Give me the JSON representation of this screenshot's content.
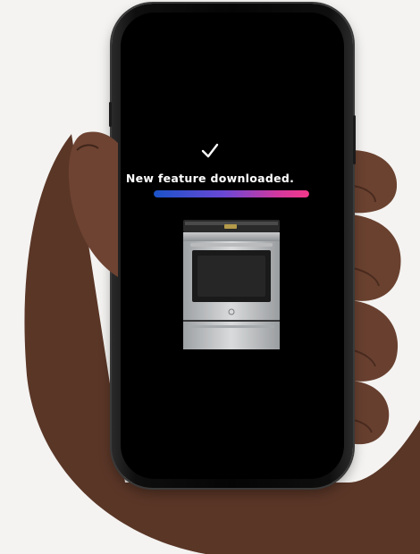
{
  "screen": {
    "headline": "New feature downloaded.",
    "check_icon": "checkmark-icon",
    "progress": 1.0
  },
  "product": {
    "icon": "electric-range-image"
  },
  "colors": {
    "background": "#f4f3f1",
    "screen": "#000000",
    "text": "#ffffff",
    "progress_start": "#1a53c9",
    "progress_end": "#f4388a"
  }
}
